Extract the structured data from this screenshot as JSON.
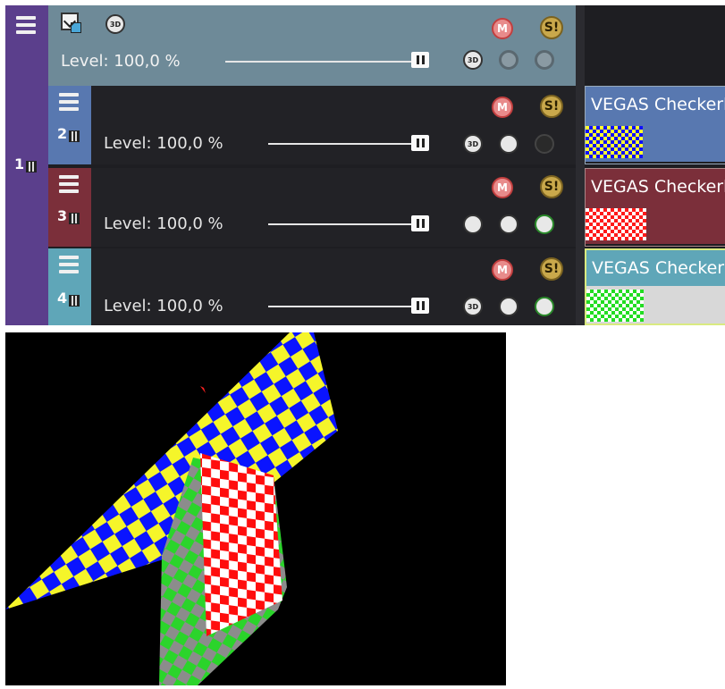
{
  "parent_track": {
    "number": "1",
    "level_text": "Level: 100,0 %",
    "level_value": 1.0,
    "color": "#5b3f8c",
    "header_color": "#6e8a98"
  },
  "tracks": [
    {
      "number": "2",
      "level_text": "Level: 100,0 %",
      "level_value": 1.0,
      "color": "#5878b0",
      "event_title": "VEGAS Checkerb",
      "event_color": "#5878b0",
      "checker_colors": [
        "#1010ff",
        "#ffff30"
      ]
    },
    {
      "number": "3",
      "level_text": "Level: 100,0 %",
      "level_value": 1.0,
      "color": "#7b2f3a",
      "event_title": "VEGAS Checkerb",
      "event_color": "#7b2f3a",
      "checker_colors": [
        "#ff1a1a",
        "#ffffff"
      ]
    },
    {
      "number": "4",
      "level_text": "Level: 100,0 %",
      "level_value": 1.0,
      "color": "#5fa6b8",
      "event_title": "VEGAS Checkerb",
      "event_color": "#5fa6b8",
      "checker_colors": [
        "#22dd22",
        "#ffffff"
      ]
    }
  ],
  "icons": {
    "mute": "M",
    "solo": "S!",
    "three_d": "3D",
    "menu": "hamburger-menu-icon",
    "bypass": "bypass-fx-icon",
    "composite": "composite-mode-icon",
    "motion": "parent-motion-icon"
  },
  "preview": {
    "colors": {
      "blue": "#0a14ff",
      "yellow": "#f5f52a",
      "red": "#ff0d0d",
      "white": "#ffffff",
      "green": "#2bd42b",
      "gray": "#8c8c8c"
    }
  }
}
